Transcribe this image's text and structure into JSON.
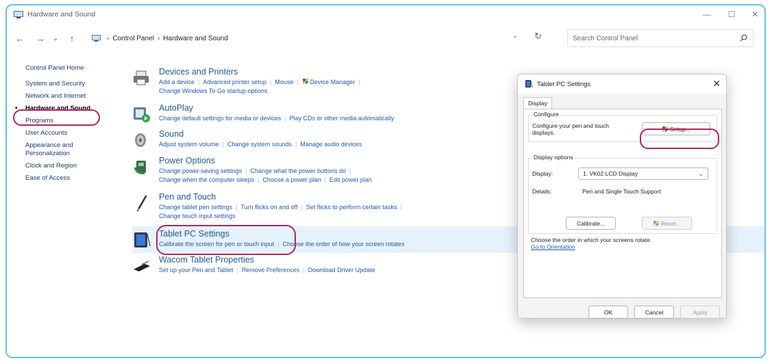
{
  "window": {
    "title": "Hardware and Sound",
    "controls": {
      "minimize": "—",
      "maximize": "☐",
      "close": "✕"
    }
  },
  "address": {
    "crumbs": [
      "Control Panel",
      "Hardware and Sound"
    ],
    "separator": "›",
    "search_placeholder": "Search Control Panel"
  },
  "sidebar": {
    "home": "Control Panel Home",
    "items": [
      {
        "label": "System and Security",
        "current": false
      },
      {
        "label": "Network and Internet",
        "current": false
      },
      {
        "label": "Hardware and Sound",
        "current": true
      },
      {
        "label": "Programs",
        "current": false
      },
      {
        "label": "User Accounts",
        "current": false
      },
      {
        "label": "Appearance and Personalization",
        "current": false
      },
      {
        "label": "Clock and Region",
        "current": false
      },
      {
        "label": "Ease of Access",
        "current": false
      }
    ]
  },
  "categories": [
    {
      "title": "Devices and Printers",
      "icon": "printer-icon",
      "lines": [
        [
          "Add a device",
          "Advanced printer setup",
          "Mouse",
          "Device Manager"
        ],
        [
          "Change Windows To Go startup options"
        ]
      ]
    },
    {
      "title": "AutoPlay",
      "icon": "autoplay-icon",
      "lines": [
        [
          "Change default settings for media or devices",
          "Play CDs or other media automatically"
        ]
      ]
    },
    {
      "title": "Sound",
      "icon": "speaker-icon",
      "lines": [
        [
          "Adjust system volume",
          "Change system sounds",
          "Manage audio devices"
        ]
      ]
    },
    {
      "title": "Power Options",
      "icon": "power-icon",
      "lines": [
        [
          "Change power-saving settings",
          "Change what the power buttons do"
        ],
        [
          "Change when the computer sleeps",
          "Choose a power plan",
          "Edit power plan"
        ]
      ]
    },
    {
      "title": "Pen and Touch",
      "icon": "pen-icon",
      "lines": [
        [
          "Change tablet pen settings",
          "Turn flicks on and off",
          "Set flicks to perform certain tasks"
        ],
        [
          "Change touch input settings"
        ]
      ]
    },
    {
      "title": "Tablet PC Settings",
      "icon": "tablet-icon",
      "lines": [
        [
          "Calibrate the screen for pen or touch input",
          "Choose the order of how your screen rotates"
        ]
      ]
    },
    {
      "title": "Wacom Tablet Properties",
      "icon": "wacom-pen-icon",
      "lines": [
        [
          "Set up your Pen and Tablet",
          "Remove Preferences",
          "Download Driver Update"
        ]
      ]
    }
  ],
  "dialog": {
    "title": "Tablet PC Settings",
    "close": "✕",
    "tab": "Display",
    "configure": {
      "label": "Configure",
      "text": "Configure your pen and touch displays.",
      "setup_button": "Setup..."
    },
    "display_options": {
      "label": "Display options",
      "display_label": "Display:",
      "display_value": "1. VK02 LCD Display",
      "details_label": "Details:",
      "details_value": "Pen and Single Touch Support",
      "calibrate_button": "Calibrate...",
      "reset_button": "Reset..."
    },
    "orientation_text": "Choose the order in which your screens rotate.",
    "orientation_link": "Go to Orientation",
    "ok": "OK",
    "cancel": "Cancel",
    "apply": "Apply"
  },
  "colors": {
    "highlight_ring": "#b8225a",
    "frame_border": "#63c5e0",
    "link": "#1f58b5"
  }
}
